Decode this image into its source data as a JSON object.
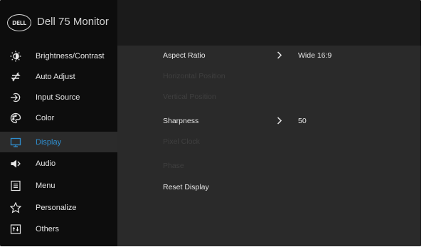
{
  "header": {
    "logo_text": "DELL",
    "title": "Dell 75 Monitor"
  },
  "sidebar": {
    "items": [
      {
        "label": "Brightness/Contrast",
        "icon": "brightness-icon"
      },
      {
        "label": "Auto Adjust",
        "icon": "auto-adjust-icon"
      },
      {
        "label": "Input Source",
        "icon": "input-source-icon"
      },
      {
        "label": "Color",
        "icon": "color-palette-icon"
      },
      {
        "label": "Display",
        "icon": "display-icon",
        "active": true
      },
      {
        "label": "Audio",
        "icon": "speaker-icon"
      },
      {
        "label": "Menu",
        "icon": "menu-icon"
      },
      {
        "label": "Personalize",
        "icon": "star-icon"
      },
      {
        "label": "Others",
        "icon": "others-icon"
      }
    ]
  },
  "display_menu": {
    "rows": [
      {
        "label": "Aspect Ratio",
        "value": "Wide 16:9",
        "enabled": true
      },
      {
        "label": "Horizontal Position",
        "value": "",
        "enabled": false
      },
      {
        "label": "Vertical Position",
        "value": "",
        "enabled": false
      },
      {
        "label": "Sharpness",
        "value": "50",
        "enabled": true
      },
      {
        "label": "Pixel Clock",
        "value": "",
        "enabled": false
      },
      {
        "label": "Phase",
        "value": "",
        "enabled": false
      },
      {
        "label": "Reset Display",
        "value": "",
        "enabled": true
      }
    ]
  },
  "colors": {
    "accent": "#2f8fd0",
    "sidebar_bg": "#0d0d0d",
    "content_bg": "#2a2a2a",
    "disabled_text": "#3f3f3f"
  }
}
